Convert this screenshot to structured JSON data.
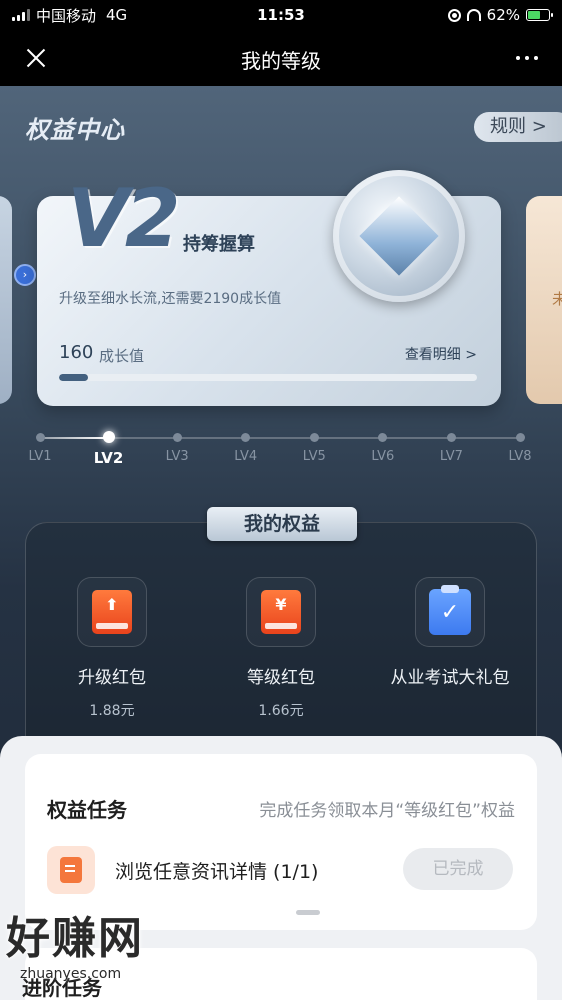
{
  "status_bar": {
    "carrier": "中国移动",
    "network": "4G",
    "time": "11:53",
    "battery": "62%"
  },
  "nav": {
    "title": "我的等级"
  },
  "hero": {
    "title": "权益中心",
    "rules_label": "规则 >"
  },
  "level_card": {
    "level": "V2",
    "level_name": "持筹握算",
    "upgrade_text": "升级至细水长流,还需要2190成长值",
    "growth_value": "160",
    "growth_unit": "成长值",
    "detail_link": "查看明细 >",
    "progress_fraction": 0.07
  },
  "side_card_right_text": "未",
  "timeline": {
    "levels": [
      "LV1",
      "LV2",
      "LV3",
      "LV4",
      "LV5",
      "LV6",
      "LV7",
      "LV8"
    ],
    "active_index": 1
  },
  "benefits": {
    "title": "我的权益",
    "items": [
      {
        "label": "升级红包",
        "value": "1.88元",
        "icon": "upgrade-red-envelope-icon"
      },
      {
        "label": "等级红包",
        "value": "1.66元",
        "icon": "yen-red-envelope-icon"
      },
      {
        "label": "从业考试大礼包",
        "value": "",
        "icon": "clipboard-check-icon"
      }
    ]
  },
  "tasks": {
    "title": "权益任务",
    "subtitle": "完成任务领取本月“等级红包”权益",
    "items": [
      {
        "label": "浏览任意资讯详情 (1/1)",
        "status": "已完成"
      }
    ],
    "next_section_title": "进阶任务"
  },
  "watermark": {
    "big": "好赚网",
    "small": "zhuanyes.com"
  },
  "colors": {
    "accent_orange": "#f4773c",
    "accent_blue": "#3d7af0",
    "card_text": "#2e4258"
  }
}
